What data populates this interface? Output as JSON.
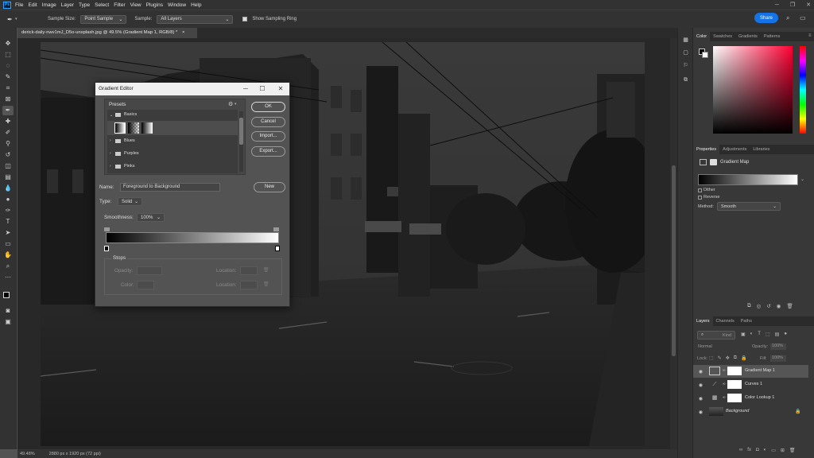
{
  "menu": {
    "logo": "Ps",
    "items": [
      "File",
      "Edit",
      "Image",
      "Layer",
      "Type",
      "Select",
      "Filter",
      "View",
      "Plugins",
      "Window",
      "Help"
    ]
  },
  "options": {
    "sample_size_label": "Sample Size:",
    "sample_size_value": "Point Sample",
    "sample_label": "Sample:",
    "sample_value": "All Layers",
    "show_ring_label": "Show Sampling Ring",
    "share_label": "Share"
  },
  "doc_tab": {
    "title": "derick-daily-nwv1mJ_D5o-unsplash.jpg @ 49.5% (Gradient Map 1, RGB/8) *",
    "close": "×"
  },
  "status": {
    "zoom": "49.48%",
    "size": "2880 px x 1920 px (72 ppi)"
  },
  "dialog": {
    "title": "Gradient Editor",
    "presets_label": "Presets",
    "folders": [
      "Basics",
      "Blues",
      "Purples",
      "Pinks"
    ],
    "buttons": {
      "ok": "OK",
      "cancel": "Cancel",
      "import": "Import...",
      "export": "Export...",
      "new": "New"
    },
    "name_label": "Name:",
    "name_value": "Foreground to Background",
    "type_label": "Type:",
    "type_value": "Solid",
    "smoothness_label": "Smoothness:",
    "smoothness_value": "100%",
    "stops_label": "Stops",
    "opacity_label": "Opacity:",
    "color_label": "Color:",
    "location_label": "Location:",
    "location_label2": "Location:"
  },
  "color_panel": {
    "tabs": [
      "Color",
      "Swatches",
      "Gradients",
      "Patterns"
    ],
    "active_tab": 0,
    "hue_color": "#ff0033"
  },
  "properties_panel": {
    "tabs": [
      "Properties",
      "Adjustments",
      "Libraries"
    ],
    "active_tab": 0,
    "header": "Gradient Map",
    "dither_label": "Dither",
    "reverse_label": "Reverse",
    "method_label": "Method:",
    "method_value": "Smooth"
  },
  "layers_panel": {
    "tabs": [
      "Layers",
      "Channels",
      "Paths"
    ],
    "active_tab": 0,
    "search_placeholder": "Kind",
    "blend_mode": "Normal",
    "opacity_label": "Opacity:",
    "opacity_value": "100%",
    "lock_label": "Lock:",
    "fill_label": "Fill:",
    "fill_value": "100%",
    "layers": [
      {
        "name": "Gradient Map 1",
        "selected": true,
        "icon": "gradient-map-icon"
      },
      {
        "name": "Curves 1",
        "selected": false,
        "icon": "curves-icon"
      },
      {
        "name": "Color Lookup 1",
        "selected": false,
        "icon": "color-lookup-icon"
      },
      {
        "name": "Background",
        "selected": false,
        "icon": "image-thumb",
        "locked": true
      }
    ]
  },
  "colors": {
    "accent": "#1473e6",
    "panel_bg": "#383838",
    "app_bg": "#323232"
  }
}
